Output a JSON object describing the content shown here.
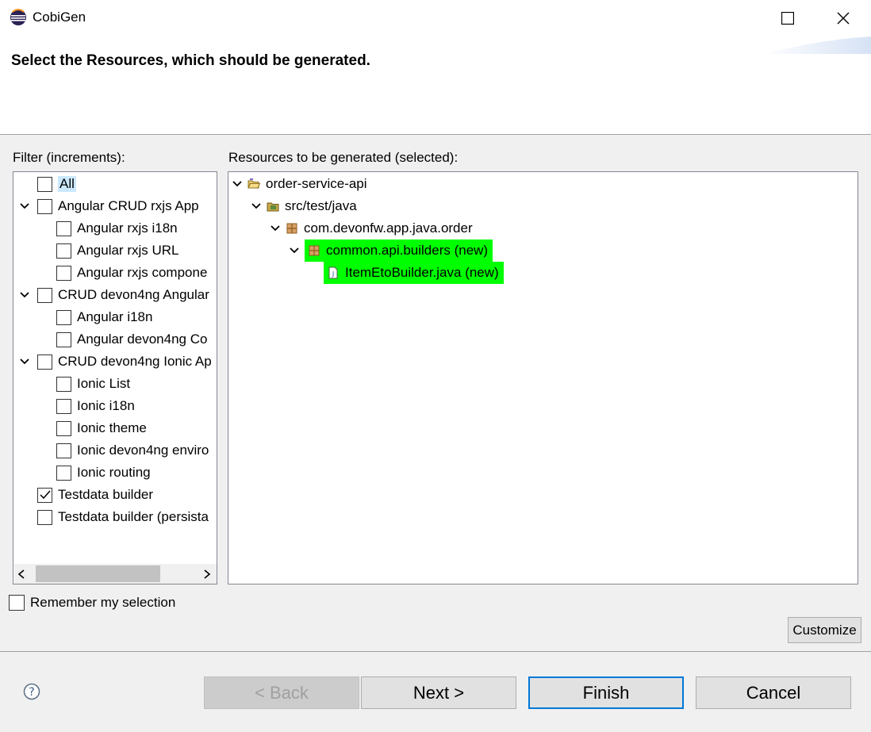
{
  "window": {
    "title": "CobiGen"
  },
  "header": {
    "title": "Select the Resources, which should be generated."
  },
  "filter": {
    "label": "Filter (increments):",
    "items": [
      {
        "label": "All",
        "checked": false,
        "level": 0,
        "expandable": false
      },
      {
        "label": "Angular CRUD rxjs App",
        "checked": false,
        "level": 0,
        "expandable": true
      },
      {
        "label": "Angular rxjs i18n",
        "checked": false,
        "level": 1,
        "expandable": false
      },
      {
        "label": "Angular rxjs URL",
        "checked": false,
        "level": 1,
        "expandable": false
      },
      {
        "label": "Angular rxjs compone",
        "checked": false,
        "level": 1,
        "expandable": false
      },
      {
        "label": "CRUD devon4ng Angular",
        "checked": false,
        "level": 0,
        "expandable": true
      },
      {
        "label": "Angular i18n",
        "checked": false,
        "level": 1,
        "expandable": false
      },
      {
        "label": "Angular devon4ng Co",
        "checked": false,
        "level": 1,
        "expandable": false
      },
      {
        "label": "CRUD devon4ng Ionic Ap",
        "checked": false,
        "level": 0,
        "expandable": true
      },
      {
        "label": "Ionic List",
        "checked": false,
        "level": 1,
        "expandable": false
      },
      {
        "label": "Ionic i18n",
        "checked": false,
        "level": 1,
        "expandable": false
      },
      {
        "label": "Ionic theme",
        "checked": false,
        "level": 1,
        "expandable": false
      },
      {
        "label": "Ionic devon4ng enviro",
        "checked": false,
        "level": 1,
        "expandable": false
      },
      {
        "label": "Ionic routing",
        "checked": false,
        "level": 1,
        "expandable": false
      },
      {
        "label": "Testdata builder",
        "checked": true,
        "level": 0,
        "expandable": false
      },
      {
        "label": "Testdata builder (persista",
        "checked": false,
        "level": 0,
        "expandable": false
      }
    ]
  },
  "resources": {
    "label": "Resources to be generated (selected):",
    "items": [
      {
        "label": "order-service-api",
        "level": 0,
        "icon": "project-folder-icon",
        "expandable": true,
        "is_new": false
      },
      {
        "label": "src/test/java",
        "level": 1,
        "icon": "source-folder-icon",
        "expandable": true,
        "is_new": false
      },
      {
        "label": "com.devonfw.app.java.order",
        "level": 2,
        "icon": "package-icon",
        "expandable": true,
        "is_new": false
      },
      {
        "label": "common.api.builders (new)",
        "level": 3,
        "icon": "package-icon",
        "expandable": true,
        "is_new": true
      },
      {
        "label": "ItemEtoBuilder.java (new)",
        "level": 4,
        "icon": "java-file-icon",
        "expandable": false,
        "is_new": true
      }
    ],
    "new_highlight_color": "#00ff00"
  },
  "remember": {
    "label": "Remember my selection",
    "checked": false
  },
  "buttons": {
    "customize": "Customize",
    "back": "< Back",
    "next": "Next >",
    "finish": "Finish",
    "cancel": "Cancel"
  },
  "accent_color": "#0078d7"
}
